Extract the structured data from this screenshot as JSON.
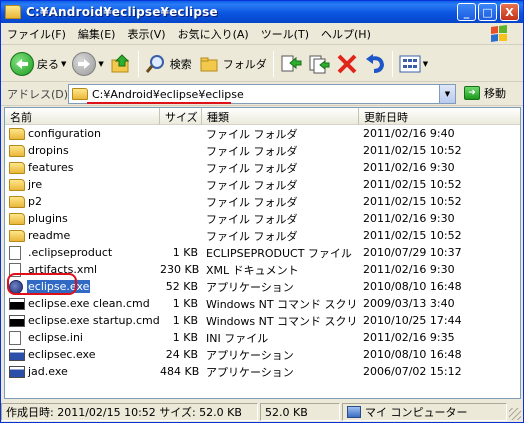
{
  "window": {
    "title": "C:¥Android¥eclipse¥eclipse",
    "min_glyph": "_",
    "max_glyph": "□",
    "close_glyph": "X"
  },
  "menu": [
    "ファイル(F)",
    "編集(E)",
    "表示(V)",
    "お気に入り(A)",
    "ツール(T)",
    "ヘルプ(H)"
  ],
  "toolbar": {
    "back_label": "戻る",
    "search_label": "検索",
    "folders_label": "フォルダ"
  },
  "address": {
    "label": "アドレス(D)",
    "value": "C:¥Android¥eclipse¥eclipse",
    "go_label": "移動"
  },
  "columns": {
    "name": "名前",
    "size": "サイズ",
    "type": "種類",
    "date": "更新日時"
  },
  "files": [
    {
      "name": "configuration",
      "size": "",
      "type": "ファイル フォルダ",
      "date": "2011/02/16 9:40",
      "icon": "folder-icon"
    },
    {
      "name": "dropins",
      "size": "",
      "type": "ファイル フォルダ",
      "date": "2011/02/15 10:52",
      "icon": "folder-icon"
    },
    {
      "name": "features",
      "size": "",
      "type": "ファイル フォルダ",
      "date": "2011/02/16 9:30",
      "icon": "folder-icon"
    },
    {
      "name": "jre",
      "size": "",
      "type": "ファイル フォルダ",
      "date": "2011/02/15 10:52",
      "icon": "folder-icon"
    },
    {
      "name": "p2",
      "size": "",
      "type": "ファイル フォルダ",
      "date": "2011/02/15 10:52",
      "icon": "folder-icon"
    },
    {
      "name": "plugins",
      "size": "",
      "type": "ファイル フォルダ",
      "date": "2011/02/16 9:30",
      "icon": "folder-icon"
    },
    {
      "name": "readme",
      "size": "",
      "type": "ファイル フォルダ",
      "date": "2011/02/15 10:52",
      "icon": "folder-icon"
    },
    {
      "name": ".eclipseproduct",
      "size": "1 KB",
      "type": "ECLIPSEPRODUCT ファイル",
      "date": "2010/07/29 10:37",
      "icon": "file-icon"
    },
    {
      "name": "artifacts.xml",
      "size": "230 KB",
      "type": "XML ドキュメント",
      "date": "2011/02/16 9:30",
      "icon": "file-icon"
    },
    {
      "name": "eclipse.exe",
      "size": "52 KB",
      "type": "アプリケーション",
      "date": "2010/08/10 16:48",
      "icon": "eclipse-icon"
    },
    {
      "name": "eclipse.exe clean.cmd",
      "size": "1 KB",
      "type": "Windows NT コマンド スクリプト",
      "date": "2009/03/13 3:40",
      "icon": "cmd-icon"
    },
    {
      "name": "eclipse.exe startup.cmd",
      "size": "1 KB",
      "type": "Windows NT コマンド スクリプト",
      "date": "2010/10/25 17:44",
      "icon": "cmd-icon"
    },
    {
      "name": "eclipse.ini",
      "size": "1 KB",
      "type": "INI ファイル",
      "date": "2011/02/16 9:35",
      "icon": "file-icon"
    },
    {
      "name": "eclipsec.exe",
      "size": "24 KB",
      "type": "アプリケーション",
      "date": "2010/08/10 16:48",
      "icon": "app-icon"
    },
    {
      "name": "jad.exe",
      "size": "484 KB",
      "type": "アプリケーション",
      "date": "2006/07/02 15:12",
      "icon": "app-icon"
    }
  ],
  "status": {
    "info": "作成日時: 2011/02/15 10:52 サイズ: 52.0 KB",
    "size": "52.0 KB",
    "location": "マイ コンピューター"
  }
}
